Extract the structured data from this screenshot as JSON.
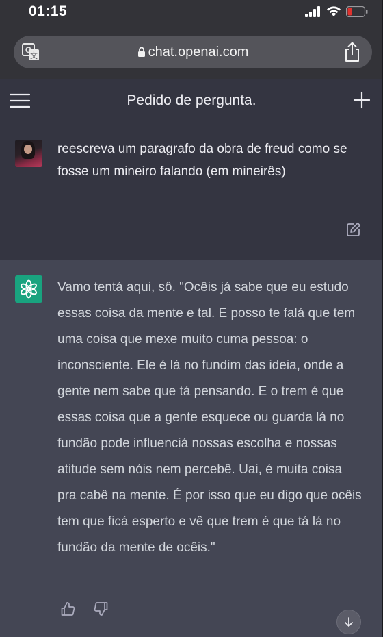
{
  "status_bar": {
    "time": "01:15",
    "icons": [
      "signal-icon",
      "wifi-icon",
      "battery-low-icon"
    ],
    "battery_color": "#e0322e"
  },
  "browser": {
    "url": "chat.openai.com",
    "icons": [
      "translate-icon",
      "lock-icon",
      "share-icon"
    ]
  },
  "chat_header": {
    "title": "Pedido de pergunta.",
    "icons": [
      "menu-icon",
      "plus-icon"
    ]
  },
  "conversation": {
    "user_message": "reescreva um paragrafo da obra de freud como se fosse um mineiro falando (em mineirês)",
    "assistant_message": "Vamo tentá aqui, sô. \"Ocêis já sabe que eu estudo essas coisa da mente e tal. E posso te falá que tem uma coisa que mexe muito cuma pessoa: o inconsciente. Ele é lá no fundim das ideia, onde a gente nem sabe que tá pensando. E o trem é que essas coisa que a gente esquece ou guarda lá no fundão pode influenciá nossas escolha e nossas atitude sem nóis nem percebê. Uai, é muita coisa pra cabê na mente. É por isso que eu digo que ocêis tem que ficá esperto e vê que trem é que tá lá no fundão da mente de ocêis.\"",
    "message_icons": [
      "edit-icon",
      "chatgpt-logo-icon",
      "thumbs-up-icon",
      "thumbs-down-icon",
      "arrow-down-icon"
    ]
  },
  "colors": {
    "user_bg": "#343541",
    "assistant_bg": "#444654",
    "gpt_accent": "#19a37f"
  }
}
